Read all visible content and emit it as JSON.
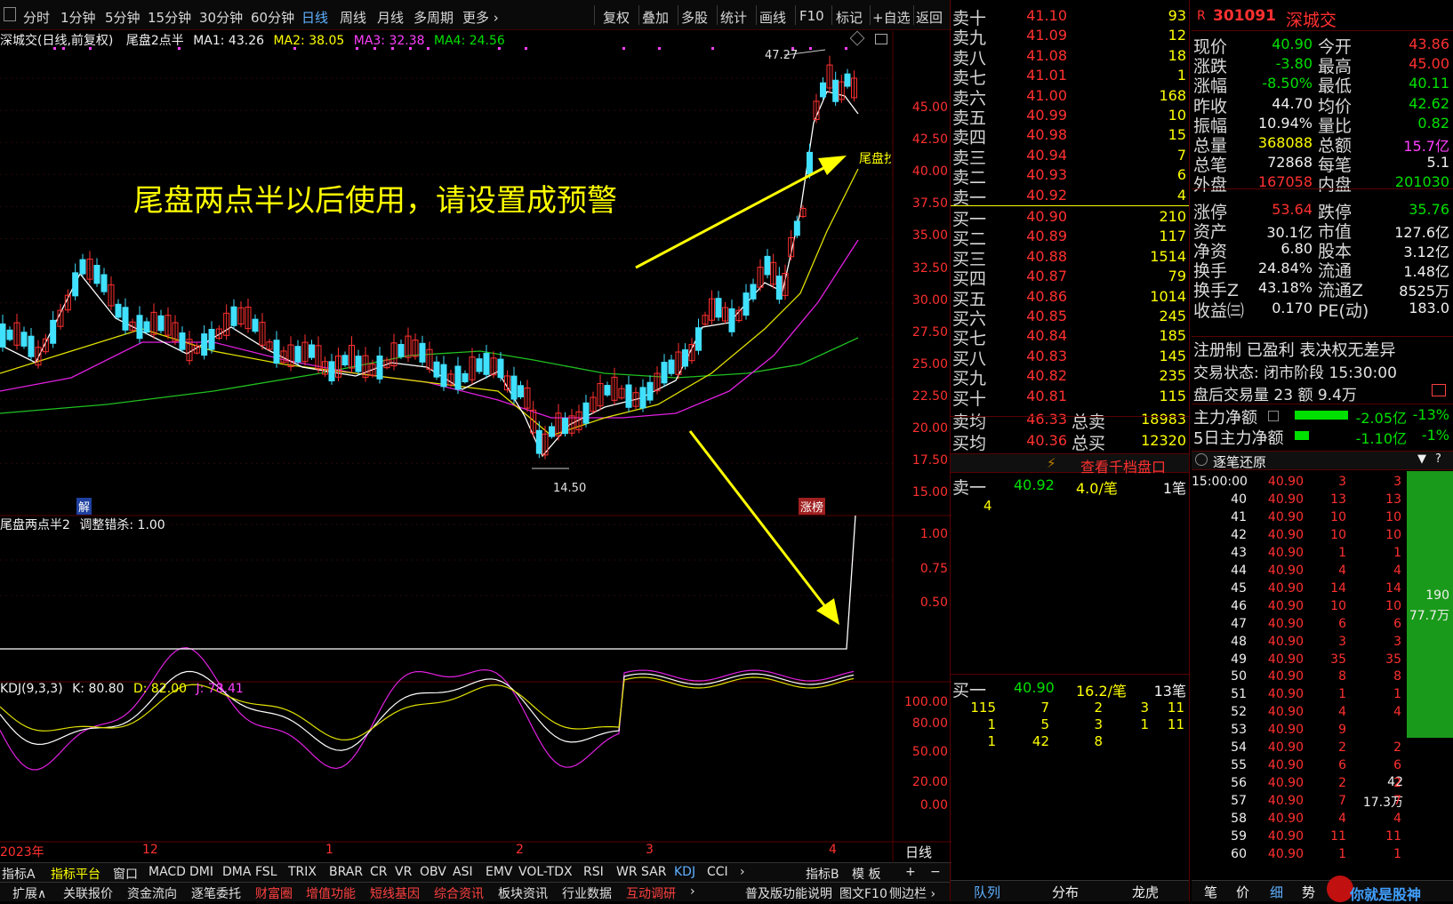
{
  "topbar": {
    "items": [
      "分时",
      "1分钟",
      "5分钟",
      "15分钟",
      "30分钟",
      "60分钟",
      "日线",
      "周线",
      "月线",
      "多周期",
      "更多 ›"
    ],
    "right_items": [
      "复权",
      "叠加",
      "多股",
      "统计",
      "画线",
      "F10",
      "标记",
      "+自选",
      "返回"
    ],
    "active": "日线"
  },
  "chart_header": {
    "title": "深城交(日线,前复权)",
    "indicator": "尾盘2点半",
    "ma1": "MA1: 43.26",
    "ma2": "MA2: 38.05",
    "ma3": "MA3: 32.38",
    "ma4": "MA4: 24.56"
  },
  "annotation": {
    "text": "尾盘两点半以后使用，请设置成预警",
    "high_label": "47.27",
    "low_label": "14.50",
    "tag_jie": "解",
    "tag_zhangbang": "涨榜",
    "tail_label": "尾盘抄"
  },
  "price_axis": [
    "45.00",
    "42.50",
    "40.00",
    "37.50",
    "35.00",
    "32.50",
    "30.00",
    "27.50",
    "25.00",
    "22.50",
    "20.00",
    "17.50",
    "15.00"
  ],
  "sub1": {
    "title": "尾盘两点半2",
    "param": "调整错杀: 1.00",
    "axis": [
      "1.00",
      "0.75",
      "0.50"
    ]
  },
  "kdj": {
    "title": "KDJ(9,3,3)",
    "k": "K: 80.80",
    "d": "D: 82.00",
    "j": "J: 78.41",
    "axis": [
      "100.00",
      "80.00",
      "50.00",
      "20.00",
      "0.00"
    ]
  },
  "date_axis": {
    "labels": [
      "2023年",
      "12",
      "1",
      "2",
      "3",
      "4"
    ],
    "period": "日线"
  },
  "bottom_tabs1": [
    "指标A",
    "指标平台",
    "窗口",
    "MACD",
    "DMI",
    "DMA",
    "FSL",
    "TRIX",
    "BRAR",
    "CR",
    "VR",
    "OBV",
    "ASI",
    "EMV",
    "VOL-TDX",
    "RSI",
    "WR",
    "SAR",
    "KDJ",
    "CCI",
    "›"
  ],
  "bottom_tabs1_right": [
    "指标B",
    "模 板",
    "+",
    "−"
  ],
  "bottom_tabs2": [
    "扩展∧",
    "关联报价",
    "资金流向",
    "逐笔委托",
    "财富圈",
    "增值功能",
    "短线基因",
    "综合资讯",
    "板块资讯",
    "行业数据",
    "互动调研",
    "›"
  ],
  "bottom_tabs2_right": [
    "普及版功能说明",
    "图文F10",
    "侧边栏 ›"
  ],
  "orderbook": {
    "sells": [
      {
        "l": "卖十",
        "p": "41.10",
        "v": "93"
      },
      {
        "l": "卖九",
        "p": "41.09",
        "v": "12"
      },
      {
        "l": "卖八",
        "p": "41.08",
        "v": "18"
      },
      {
        "l": "卖七",
        "p": "41.01",
        "v": "1"
      },
      {
        "l": "卖六",
        "p": "41.00",
        "v": "168"
      },
      {
        "l": "卖五",
        "p": "40.99",
        "v": "10"
      },
      {
        "l": "卖四",
        "p": "40.98",
        "v": "15"
      },
      {
        "l": "卖三",
        "p": "40.94",
        "v": "7"
      },
      {
        "l": "卖二",
        "p": "40.93",
        "v": "6"
      },
      {
        "l": "卖一",
        "p": "40.92",
        "v": "4"
      }
    ],
    "buys": [
      {
        "l": "买一",
        "p": "40.90",
        "v": "210"
      },
      {
        "l": "买二",
        "p": "40.89",
        "v": "117"
      },
      {
        "l": "买三",
        "p": "40.88",
        "v": "1514"
      },
      {
        "l": "买四",
        "p": "40.87",
        "v": "79"
      },
      {
        "l": "买五",
        "p": "40.86",
        "v": "1014"
      },
      {
        "l": "买六",
        "p": "40.85",
        "v": "245"
      },
      {
        "l": "买七",
        "p": "40.84",
        "v": "185"
      },
      {
        "l": "买八",
        "p": "40.83",
        "v": "145"
      },
      {
        "l": "买九",
        "p": "40.82",
        "v": "235"
      },
      {
        "l": "买十",
        "p": "40.81",
        "v": "115"
      }
    ],
    "avg_sell": {
      "l": "卖均",
      "p": "46.33",
      "k": "总卖",
      "v": "18983"
    },
    "avg_buy": {
      "l": "买均",
      "p": "40.36",
      "k": "总买",
      "v": "12320"
    },
    "view_link": "查看千档盘口",
    "sell1_detail": {
      "l": "卖一",
      "p": "40.92",
      "per": "4.0/笔",
      "cnt": "1笔",
      "q": [
        "4"
      ]
    },
    "buy1_detail": {
      "l": "买一",
      "p": "40.90",
      "per": "16.2/笔",
      "cnt": "13笔",
      "rows": [
        [
          "115",
          "7",
          "2",
          "3",
          "11"
        ],
        [
          "1",
          "5",
          "3",
          "1",
          "11"
        ],
        [
          "1",
          "42",
          "8",
          "",
          ""
        ]
      ]
    }
  },
  "quote": {
    "code": "301091",
    "name": "深城交",
    "rows": [
      {
        "k1": "现价",
        "v1": "40.90",
        "c1": "grn",
        "k2": "今开",
        "v2": "43.86",
        "c2": "red"
      },
      {
        "k1": "涨跌",
        "v1": "-3.80",
        "c1": "grn",
        "k2": "最高",
        "v2": "45.00",
        "c2": "red"
      },
      {
        "k1": "涨幅",
        "v1": "-8.50%",
        "c1": "grn",
        "k2": "最低",
        "v2": "40.11",
        "c2": "grn"
      },
      {
        "k1": "昨收",
        "v1": "44.70",
        "c1": "wht",
        "k2": "均价",
        "v2": "42.62",
        "c2": "grn"
      },
      {
        "k1": "振幅",
        "v1": "10.94%",
        "c1": "wht",
        "k2": "量比",
        "v2": "0.82",
        "c2": "grn"
      },
      {
        "k1": "总量",
        "v1": "368088",
        "c1": "yel",
        "k2": "总额",
        "v2": "15.7亿",
        "c2": "mag"
      },
      {
        "k1": "总笔",
        "v1": "72868",
        "c1": "wht",
        "k2": "每笔",
        "v2": "5.1",
        "c2": "wht"
      },
      {
        "k1": "外盘",
        "v1": "167058",
        "c1": "red",
        "k2": "内盘",
        "v2": "201030",
        "c2": "grn"
      },
      {
        "k1": "涨停",
        "v1": "53.64",
        "c1": "red",
        "k2": "跌停",
        "v2": "35.76",
        "c2": "grn"
      },
      {
        "k1": "资产",
        "v1": "30.1亿",
        "c1": "wht",
        "k2": "市值",
        "v2": "127.6亿",
        "c2": "wht"
      },
      {
        "k1": "净资",
        "v1": "6.80",
        "c1": "wht",
        "k2": "股本",
        "v2": "3.12亿",
        "c2": "wht"
      },
      {
        "k1": "换手",
        "v1": "24.84%",
        "c1": "wht",
        "k2": "流通",
        "v2": "1.48亿",
        "c2": "wht"
      },
      {
        "k1": "换手Z",
        "v1": "43.18%",
        "c1": "wht",
        "k2": "流通Z",
        "v2": "8525万",
        "c2": "wht"
      },
      {
        "k1": "收益㈢",
        "v1": "0.170",
        "c1": "wht",
        "k2": "PE(动)",
        "v2": "183.0",
        "c2": "wht"
      }
    ],
    "info1": "注册制 已盈利 表决权无差异",
    "info2": "交易状态: 闭市阶段 15:30:00",
    "info3": "盘后交易量 23 额 9.4万",
    "flow1": {
      "k": "主力净额",
      "v": "-2.05亿",
      "p": "-13%"
    },
    "flow2": {
      "k": "5日主力净额",
      "v": "-1.10亿",
      "p": "-1%"
    }
  },
  "ticks": {
    "title": "逐笔还原",
    "rows": [
      [
        "15:00:00",
        "40.90",
        "3",
        "3"
      ],
      [
        "40",
        "40.90",
        "13",
        "13"
      ],
      [
        "41",
        "40.90",
        "10",
        "10"
      ],
      [
        "42",
        "40.90",
        "10",
        "10"
      ],
      [
        "43",
        "40.90",
        "1",
        "1"
      ],
      [
        "44",
        "40.90",
        "4",
        "4"
      ],
      [
        "45",
        "40.90",
        "14",
        "14"
      ],
      [
        "46",
        "40.90",
        "10",
        "10"
      ],
      [
        "47",
        "40.90",
        "6",
        "6"
      ],
      [
        "48",
        "40.90",
        "3",
        "3"
      ],
      [
        "49",
        "40.90",
        "35",
        "35"
      ],
      [
        "50",
        "40.90",
        "8",
        "8"
      ],
      [
        "51",
        "40.90",
        "1",
        "1"
      ],
      [
        "52",
        "40.90",
        "4",
        "4"
      ],
      [
        "53",
        "40.90",
        "9",
        ""
      ],
      [
        "54",
        "40.90",
        "2",
        "2"
      ],
      [
        "55",
        "40.90",
        "6",
        "6"
      ],
      [
        "56",
        "40.90",
        "2",
        "2"
      ],
      [
        "57",
        "40.90",
        "7",
        "7"
      ],
      [
        "58",
        "40.90",
        "4",
        "4"
      ],
      [
        "59",
        "40.90",
        "11",
        "11"
      ],
      [
        "60",
        "40.90",
        "1",
        "1"
      ]
    ],
    "bar1": {
      "a": "190",
      "b": "77.7万"
    },
    "bar2": {
      "a": "42",
      "b": "17.3万"
    }
  },
  "right_tabs": [
    "笔",
    "价",
    "细",
    "势"
  ],
  "mid_tabs": [
    "队列",
    "分布",
    "龙虎"
  ],
  "watermark": "你就是股神"
}
